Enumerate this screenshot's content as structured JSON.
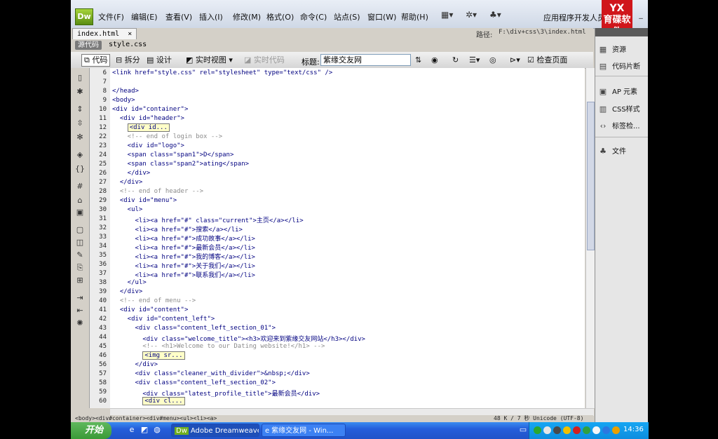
{
  "app": {
    "logo": "Dw",
    "menus": [
      "文件(F)",
      "编辑(E)",
      "查看(V)",
      "插入(I)",
      "修改(M)",
      "格式(O)",
      "命令(C)",
      "站点(S)",
      "窗口(W)",
      "帮助(H)"
    ],
    "workspace": "应用程序开发人员",
    "brand_logo": "育碟软件"
  },
  "document": {
    "tab_name": "index.html",
    "tab_close": "×",
    "path_label": "路径:",
    "path_value": "F:\\div+css\\3\\index.html",
    "source_button": "源代码",
    "related_file": "style.css"
  },
  "toolbar": {
    "code": "代码",
    "split": "拆分",
    "design": "设计",
    "live_view": "实时视图",
    "live_code": "实时代码",
    "title_label": "标题:",
    "title_value": "紫缘交友网",
    "check_page": "检查页面"
  },
  "code_lines": [
    {
      "n": "6",
      "text": "<link href=\"style.css\" rel=\"stylesheet\" type=\"text/css\" />"
    },
    {
      "n": "7",
      "text": ""
    },
    {
      "n": "8",
      "text": "</head>"
    },
    {
      "n": "9",
      "text": "<body>"
    },
    {
      "n": "10",
      "text": "<div id=\"container\">"
    },
    {
      "n": "11",
      "text": "  <div id=\"header\">"
    },
    {
      "n": "12",
      "text": "<div id...",
      "boxed": true,
      "indent": "    "
    },
    {
      "n": "22",
      "text": "    <!-- end of login box -->",
      "comment": true
    },
    {
      "n": "23",
      "text": "    <div id=\"logo\">"
    },
    {
      "n": "24",
      "text": "    <span class=\"span1\">D</span>"
    },
    {
      "n": "25",
      "text": "    <span class=\"span2\">ating</span>"
    },
    {
      "n": "26",
      "text": "    </div>"
    },
    {
      "n": "27",
      "text": "  </div>"
    },
    {
      "n": "28",
      "text": "  <!-- end of header -->",
      "comment": true
    },
    {
      "n": "29",
      "text": "  <div id=\"menu\">"
    },
    {
      "n": "30",
      "text": "    <ul>"
    },
    {
      "n": "31",
      "text": "      <li><a href=\"#\" class=\"current\">主页</a></li>"
    },
    {
      "n": "32",
      "text": "      <li><a href=\"#\">搜索</a></li>"
    },
    {
      "n": "33",
      "text": "      <li><a href=\"#\">成功故事</a></li>"
    },
    {
      "n": "34",
      "text": "      <li><a href=\"#\">最新会员</a></li>"
    },
    {
      "n": "35",
      "text": "      <li><a href=\"#\">我的博客</a></li>"
    },
    {
      "n": "36",
      "text": "      <li><a href=\"#\">关于我们</a></li>"
    },
    {
      "n": "37",
      "text": "      <li><a href=\"#\">联系我们</a></li>"
    },
    {
      "n": "38",
      "text": "    </ul>"
    },
    {
      "n": "39",
      "text": "  </div>"
    },
    {
      "n": "40",
      "text": "  <!-- end of menu -->",
      "comment": true
    },
    {
      "n": "41",
      "text": "  <div id=\"content\">"
    },
    {
      "n": "42",
      "text": "    <div id=\"content_left\">"
    },
    {
      "n": "43",
      "text": "      <div class=\"content_left_section_01\">"
    },
    {
      "n": "44",
      "text": "        <div class=\"welcome_title\"><h3>欢迎来到紫缘交友网站</h3></div>"
    },
    {
      "n": "45",
      "text": "        <!-- <h1>Welcome to our Dating website!</h1> -->",
      "comment": true
    },
    {
      "n": "46",
      "text": "<img sr...",
      "boxed": true,
      "indent": "        "
    },
    {
      "n": "56",
      "text": "      </div>"
    },
    {
      "n": "57",
      "text": "      <div class=\"cleaner_with_divider\">&nbsp;</div>"
    },
    {
      "n": "58",
      "text": "      <div class=\"content_left_section_02\">"
    },
    {
      "n": "59",
      "text": "        <div class=\"latest_profile_title\">最新会员</div>"
    },
    {
      "n": "60",
      "text": "<div cl...",
      "boxed": true,
      "indent": "        "
    }
  ],
  "status": {
    "tag_selector": "<body><div#container><div#menu><ul><li><a>",
    "info": "48 K / 7 秒  Unicode (UTF-8)"
  },
  "panels": [
    "资源",
    "代码片断",
    "AP 元素",
    "CSS样式",
    "标签检...",
    "文件"
  ],
  "taskbar": {
    "start": "开始",
    "tasks": [
      "Adobe Dreamweave...",
      "紫缘交友网 - Win..."
    ],
    "clock": "14:36"
  },
  "colors": {
    "code_tag": "#000080",
    "comment": "#8c8c8c",
    "taskbar": "#245edb",
    "start": "#3a9a37"
  }
}
